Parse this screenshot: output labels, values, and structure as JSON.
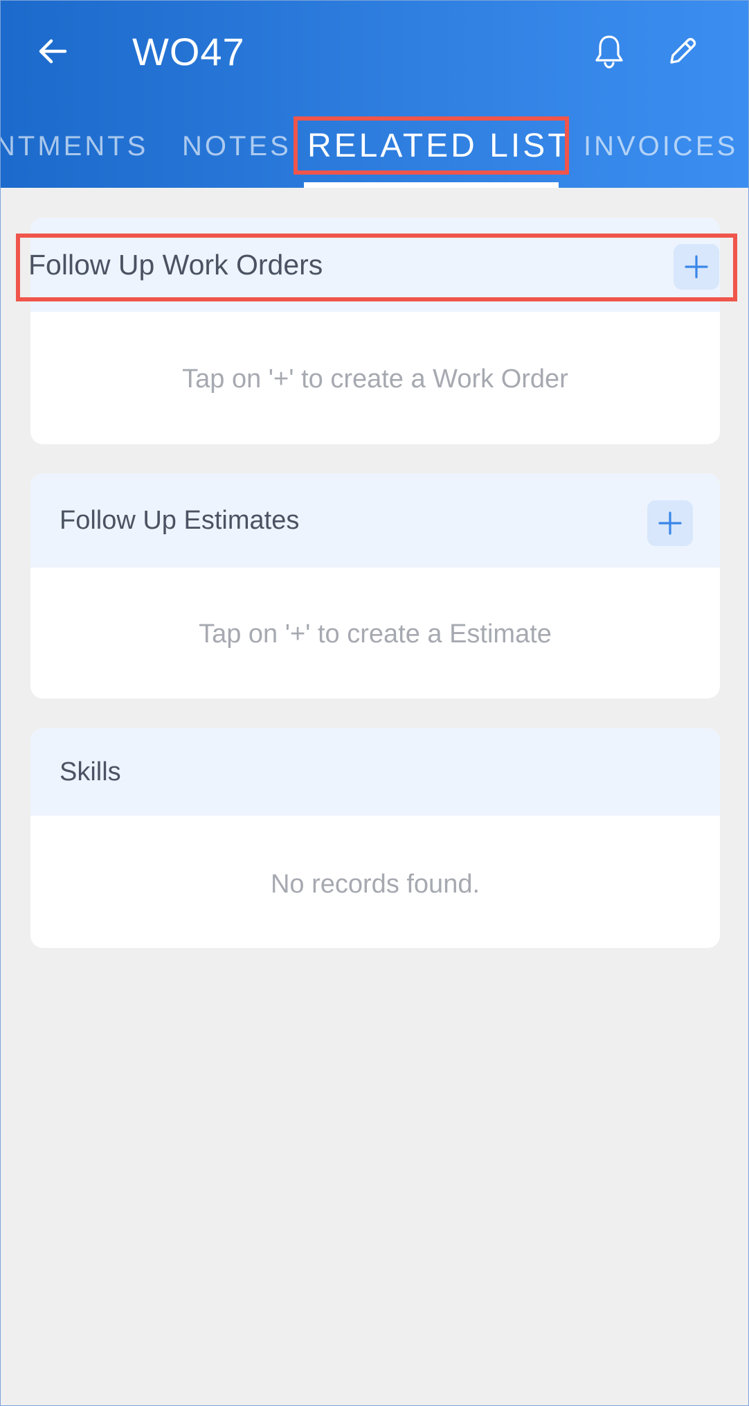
{
  "header": {
    "title": "WO47",
    "back_icon": "arrow-left-icon",
    "notification_icon": "bell-icon",
    "edit_icon": "pencil-icon",
    "colors": {
      "gradient_start": "#1c6acb",
      "gradient_end": "#3b8ef0"
    }
  },
  "tabs": [
    {
      "label": "NTMENTS",
      "active": false
    },
    {
      "label": "NOTES",
      "active": false
    },
    {
      "label": "RELATED LIST",
      "active": true
    },
    {
      "label": "INVOICES",
      "active": false
    }
  ],
  "sections": [
    {
      "title": "Follow Up Work Orders",
      "add_icon": "plus-icon",
      "empty_message": "Tap on '+' to create a Work Order"
    },
    {
      "title": "Follow Up Estimates",
      "add_icon": "plus-icon",
      "empty_message": "Tap on '+' to create a Estimate"
    },
    {
      "title": "Skills",
      "empty_message": "No records found."
    }
  ],
  "annotation_color": "#f0554b"
}
